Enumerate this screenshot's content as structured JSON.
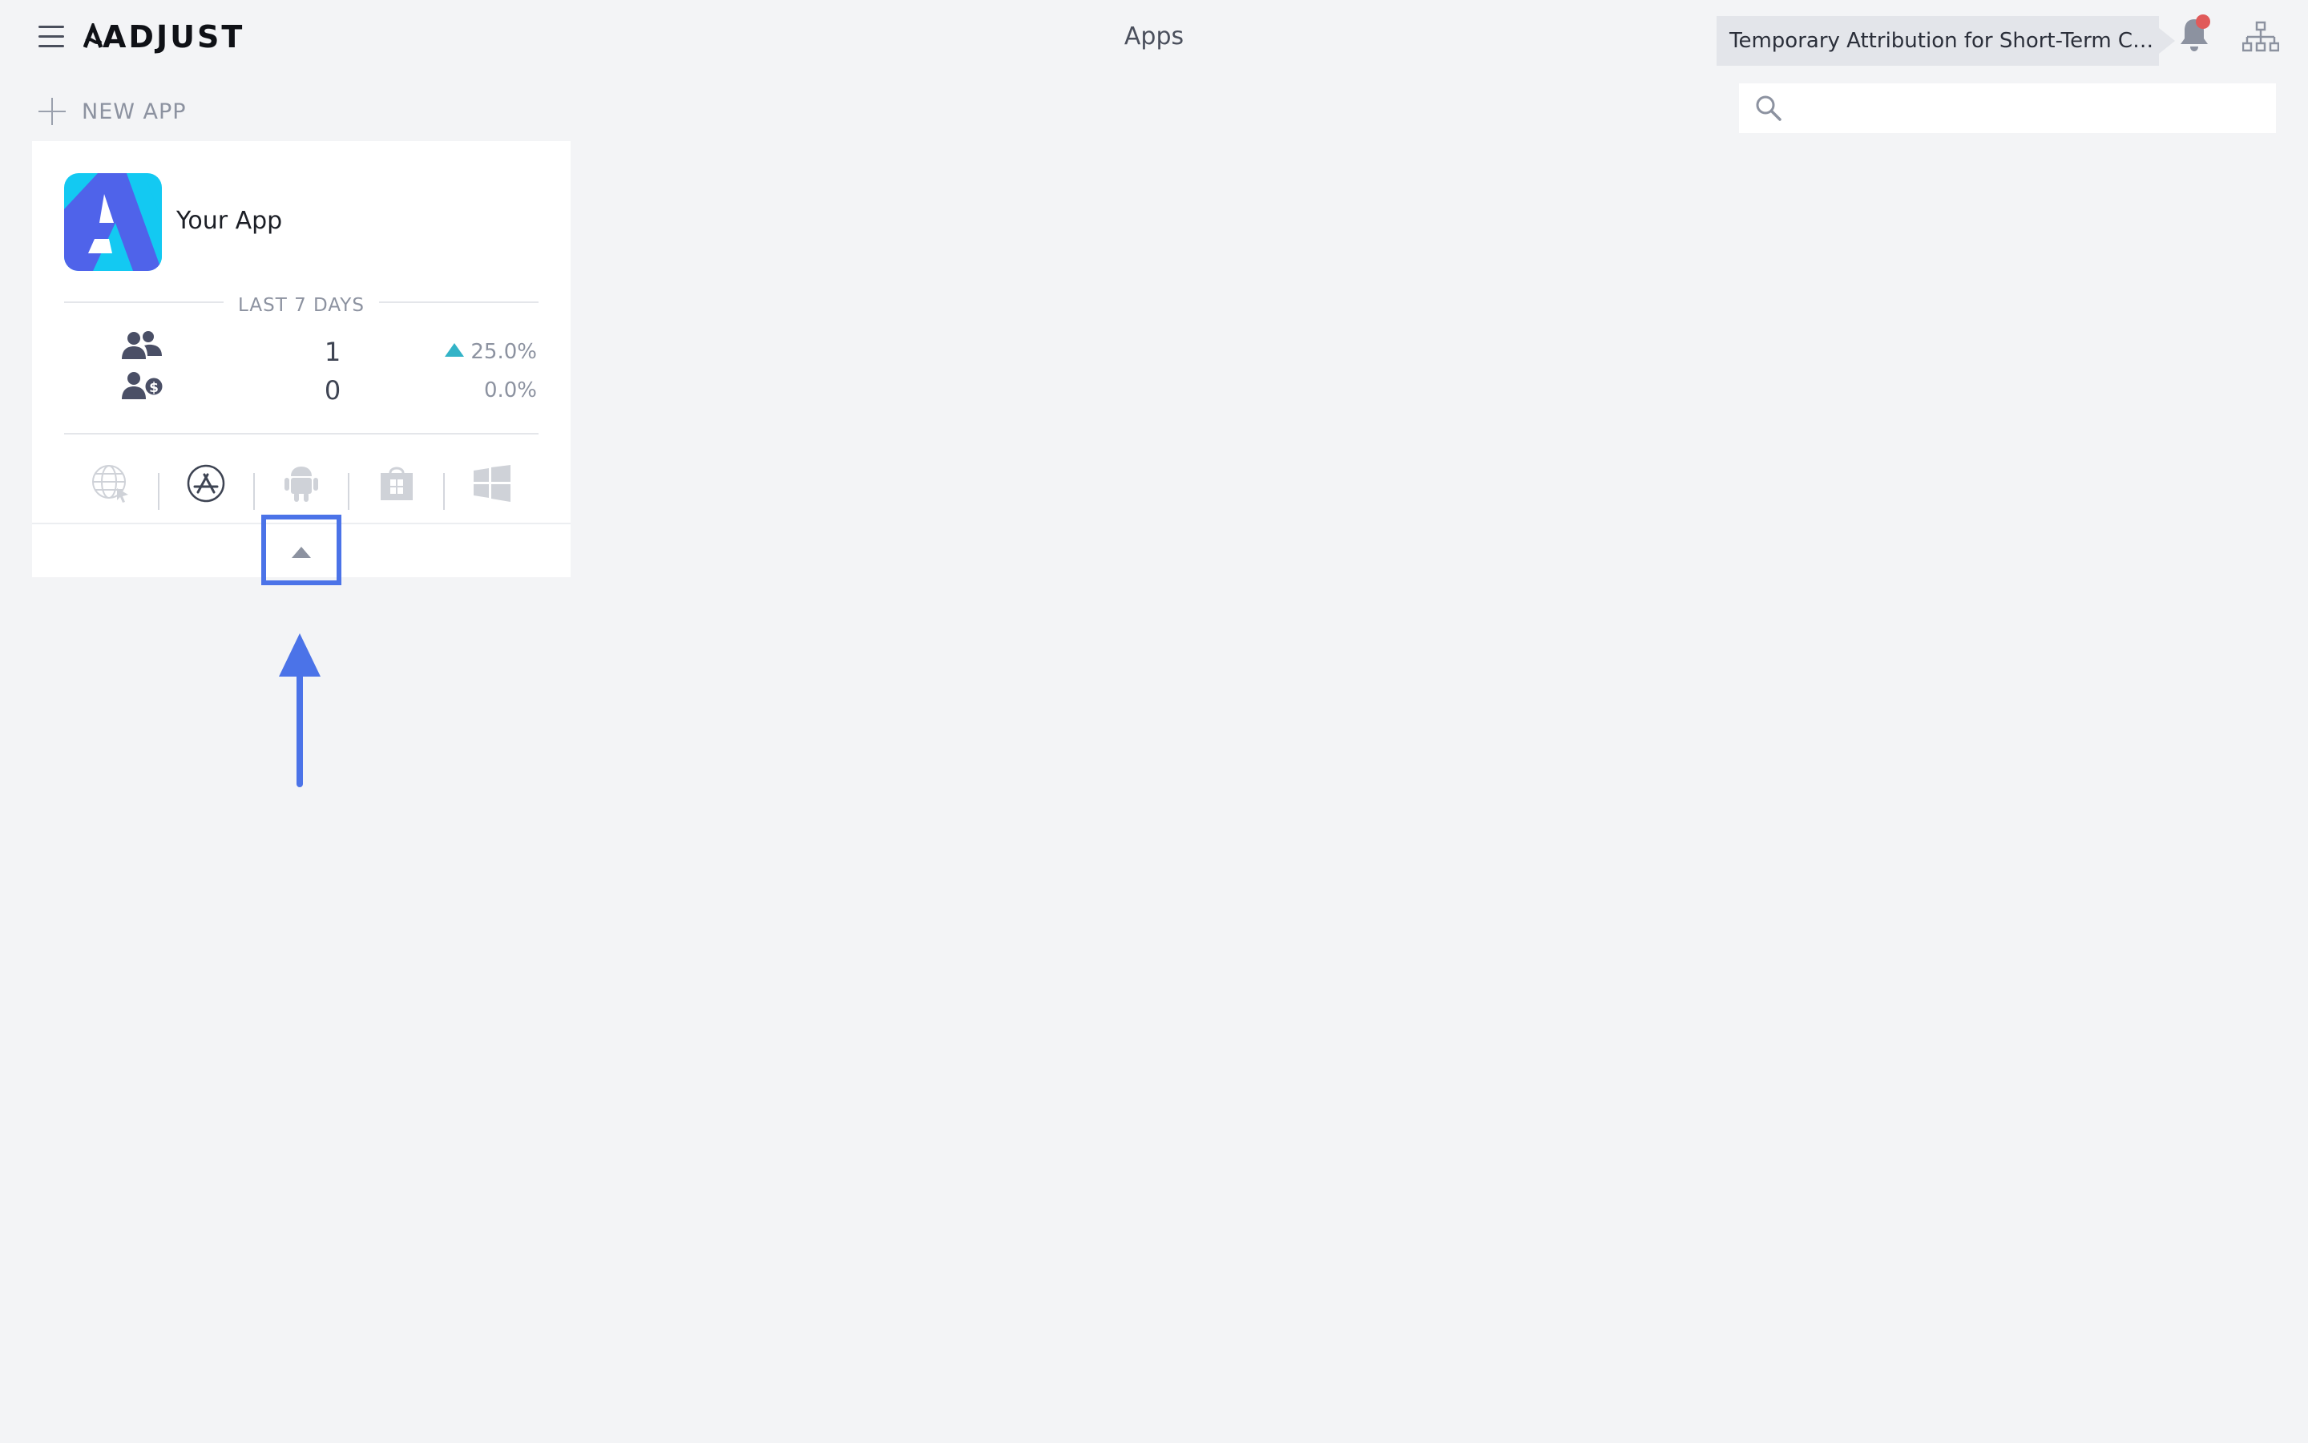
{
  "header": {
    "brand": "ADJUST",
    "title": "Apps",
    "announcement": "Temporary Attribution for Short-Term Campaigns",
    "notification_badge_color": "#e05a5a"
  },
  "toolbar": {
    "new_app_label": "NEW APP",
    "search_placeholder": ""
  },
  "app_card": {
    "name": "Your App",
    "period_label": "LAST 7 DAYS",
    "stats": [
      {
        "icon": "users-icon",
        "value": "1",
        "change": "25.0%",
        "trend": "up"
      },
      {
        "icon": "paying-users-icon",
        "value": "0",
        "change": "0.0%",
        "trend": "none"
      }
    ],
    "platforms": [
      {
        "icon": "web-icon",
        "active": false
      },
      {
        "icon": "app-store-icon",
        "active": true
      },
      {
        "icon": "android-icon",
        "active": false
      },
      {
        "icon": "store-bag-icon",
        "active": false
      },
      {
        "icon": "windows-icon",
        "active": false
      }
    ]
  },
  "colors": {
    "accent": "#4b73e8",
    "trend_up": "#33b3c7",
    "background": "#f3f4f6"
  }
}
